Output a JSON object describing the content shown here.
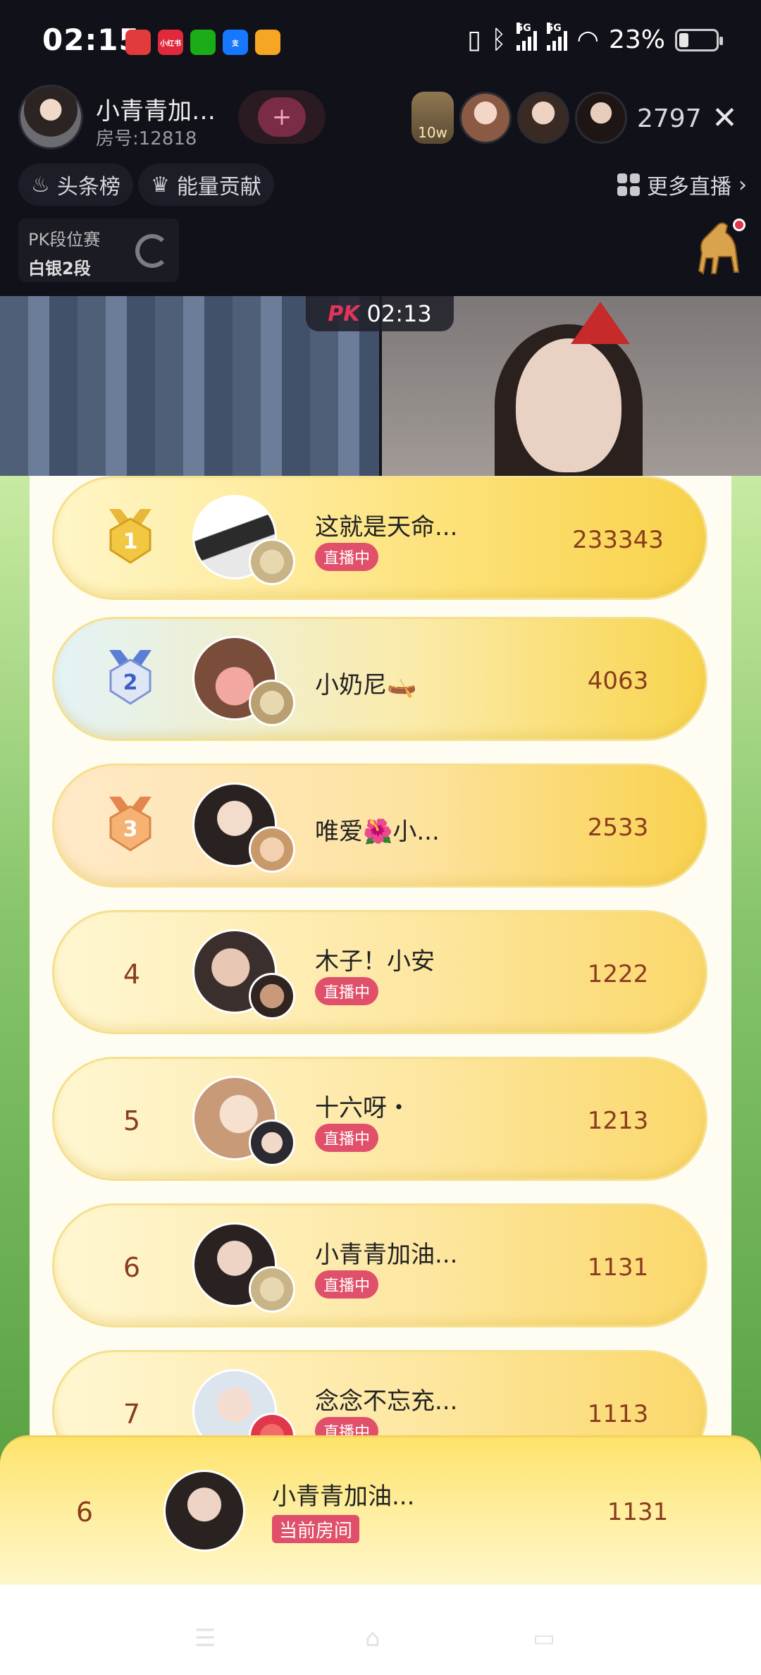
{
  "status_bar": {
    "time": "02:15",
    "app_icons": [
      {
        "icon": "app-icon-1",
        "label": "",
        "color": "#e23b3b"
      },
      {
        "icon": "xiaohongshu-icon",
        "label": "小红书",
        "color": "#e02a3c"
      },
      {
        "icon": "wechat-icon",
        "label": "",
        "color": "#1aad19"
      },
      {
        "icon": "alipay-icon",
        "label": "支",
        "color": "#1677ff"
      },
      {
        "icon": "video-app-icon",
        "label": "",
        "color": "#f5a623"
      }
    ],
    "network": "5G",
    "battery": "23%",
    "battery_level": 0.23
  },
  "header": {
    "host_name": "小青青加…",
    "room_number": "房号:12818",
    "follow_icon": "+",
    "badge_10w": "10w",
    "viewer_count": "2797",
    "close": "✕",
    "tab_headline": "头条榜",
    "tab_energy": "能量贡献",
    "more_live": "更多直播",
    "pk_rank_title": "PK段位赛",
    "pk_rank_level": "白银2段"
  },
  "video": {
    "pk_label": "PK",
    "pk_timer": "02:13"
  },
  "ranking": [
    {
      "rank": "1",
      "name": "这就是天命...",
      "score": "233343",
      "live": "直播中",
      "style": "gold"
    },
    {
      "rank": "2",
      "name": "小奶尼🛶",
      "score": "4063",
      "live": "",
      "style": "silver"
    },
    {
      "rank": "3",
      "name": "唯爱🌺小...",
      "score": "2533",
      "live": "",
      "style": "bronze"
    },
    {
      "rank": "4",
      "name": "木子！小安",
      "score": "1222",
      "live": "直播中",
      "style": "normal"
    },
    {
      "rank": "5",
      "name": "十六呀・",
      "score": "1213",
      "live": "直播中",
      "style": "normal"
    },
    {
      "rank": "6",
      "name": "小青青加油...",
      "score": "1131",
      "live": "直播中",
      "style": "normal"
    },
    {
      "rank": "7",
      "name": "念念不忘充...",
      "score": "1113",
      "live": "直播中",
      "style": "normal"
    }
  ],
  "current_room": {
    "rank": "6",
    "name": "小青青加油...",
    "tag": "当前房间",
    "score": "1131"
  },
  "nav": {
    "menu": "☰",
    "home": "⌂",
    "back": "▭"
  }
}
